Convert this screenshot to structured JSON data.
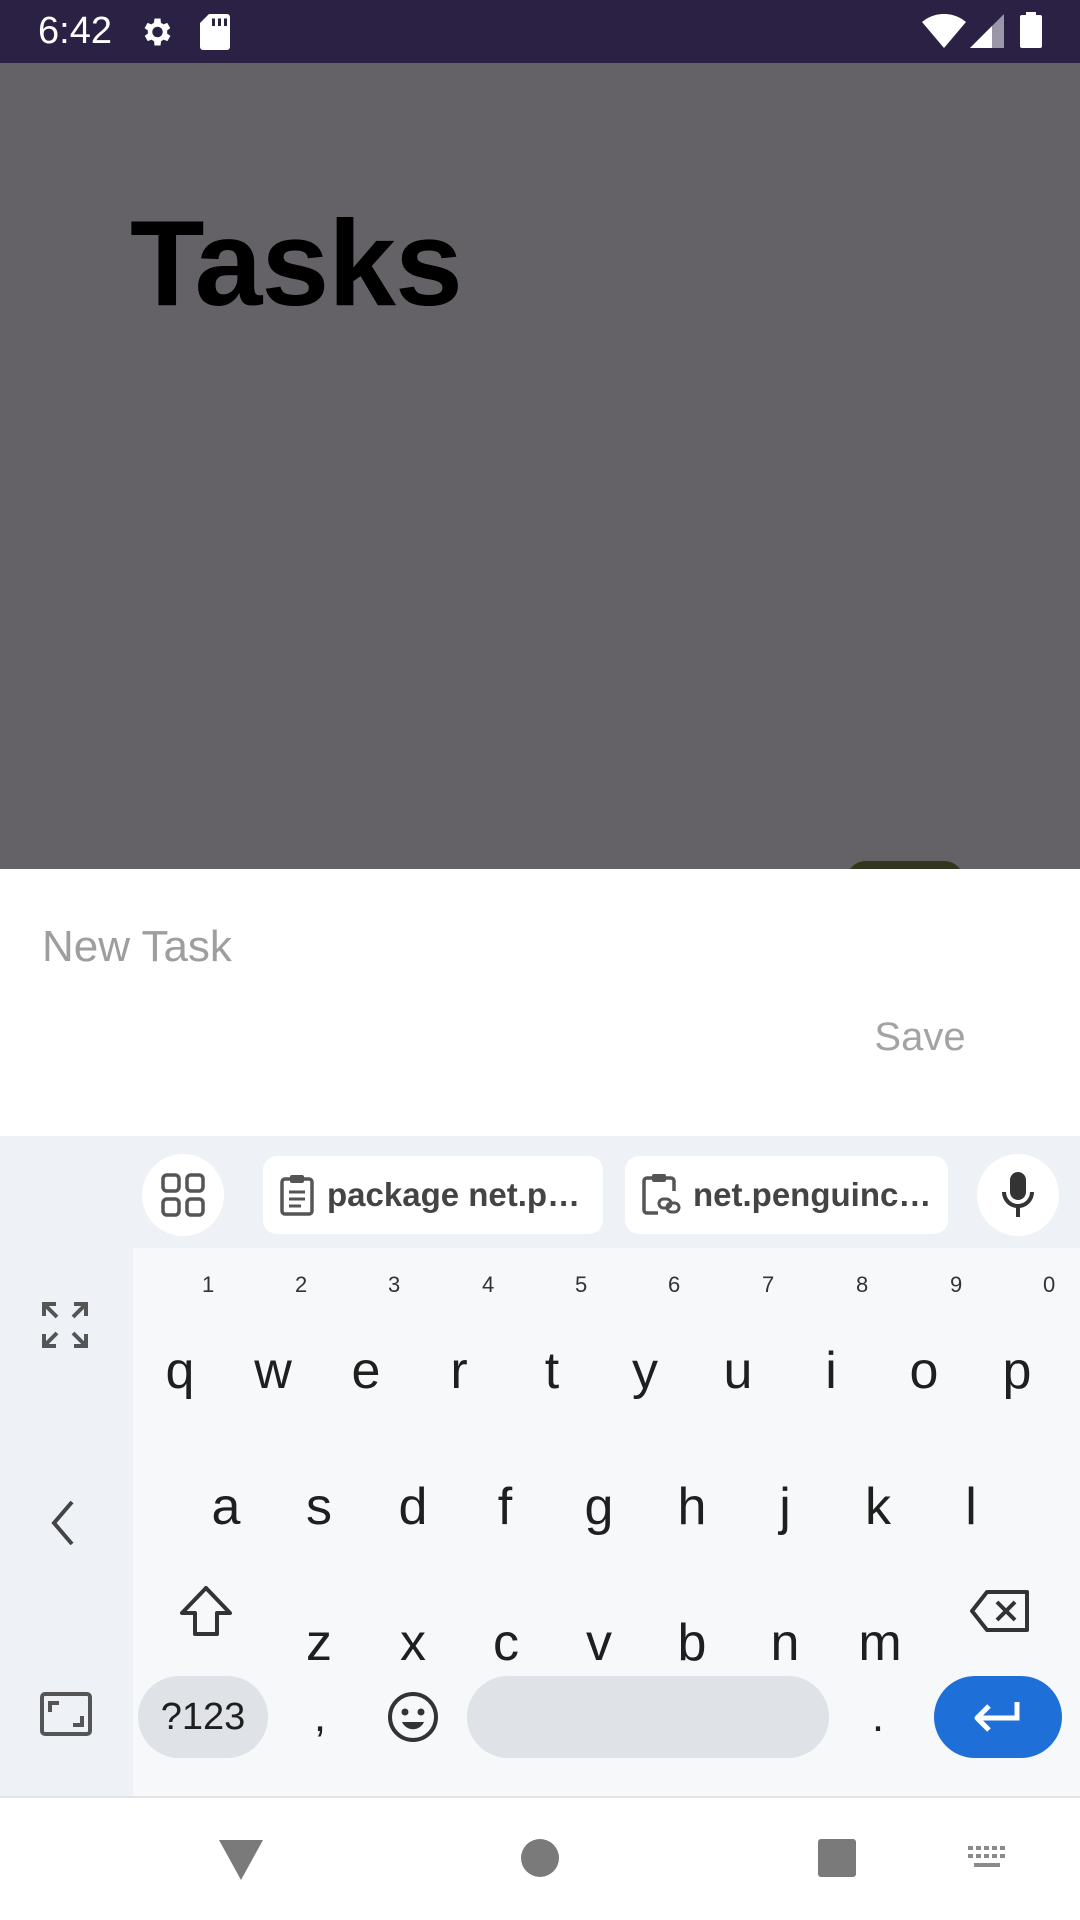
{
  "status_bar": {
    "time": "6:42",
    "icons": [
      "gear-icon",
      "sd-card-icon",
      "wifi-icon",
      "signal-icon",
      "battery-icon"
    ]
  },
  "app": {
    "title": "Tasks"
  },
  "sheet": {
    "input_placeholder": "New Task",
    "input_value": "",
    "save_label": "Save"
  },
  "keyboard": {
    "suggestions": [
      {
        "icon": "clipboard-icon",
        "text": "package net.p…"
      },
      {
        "icon": "clipboard-link-icon",
        "text": "net.penguinc…"
      }
    ],
    "row1": [
      {
        "key": "q",
        "hint": "1"
      },
      {
        "key": "w",
        "hint": "2"
      },
      {
        "key": "e",
        "hint": "3"
      },
      {
        "key": "r",
        "hint": "4"
      },
      {
        "key": "t",
        "hint": "5"
      },
      {
        "key": "y",
        "hint": "6"
      },
      {
        "key": "u",
        "hint": "7"
      },
      {
        "key": "i",
        "hint": "8"
      },
      {
        "key": "o",
        "hint": "9"
      },
      {
        "key": "p",
        "hint": "0"
      }
    ],
    "row2": [
      "a",
      "s",
      "d",
      "f",
      "g",
      "h",
      "j",
      "k",
      "l"
    ],
    "row3": [
      "z",
      "x",
      "c",
      "v",
      "b",
      "n",
      "m"
    ],
    "symbols_label": "?123",
    "comma": ",",
    "period": ".",
    "accent_color": "#1f6fd9"
  },
  "nav": {
    "icons": [
      "back-icon",
      "home-icon",
      "recents-icon",
      "keyboard-switch-icon"
    ]
  }
}
